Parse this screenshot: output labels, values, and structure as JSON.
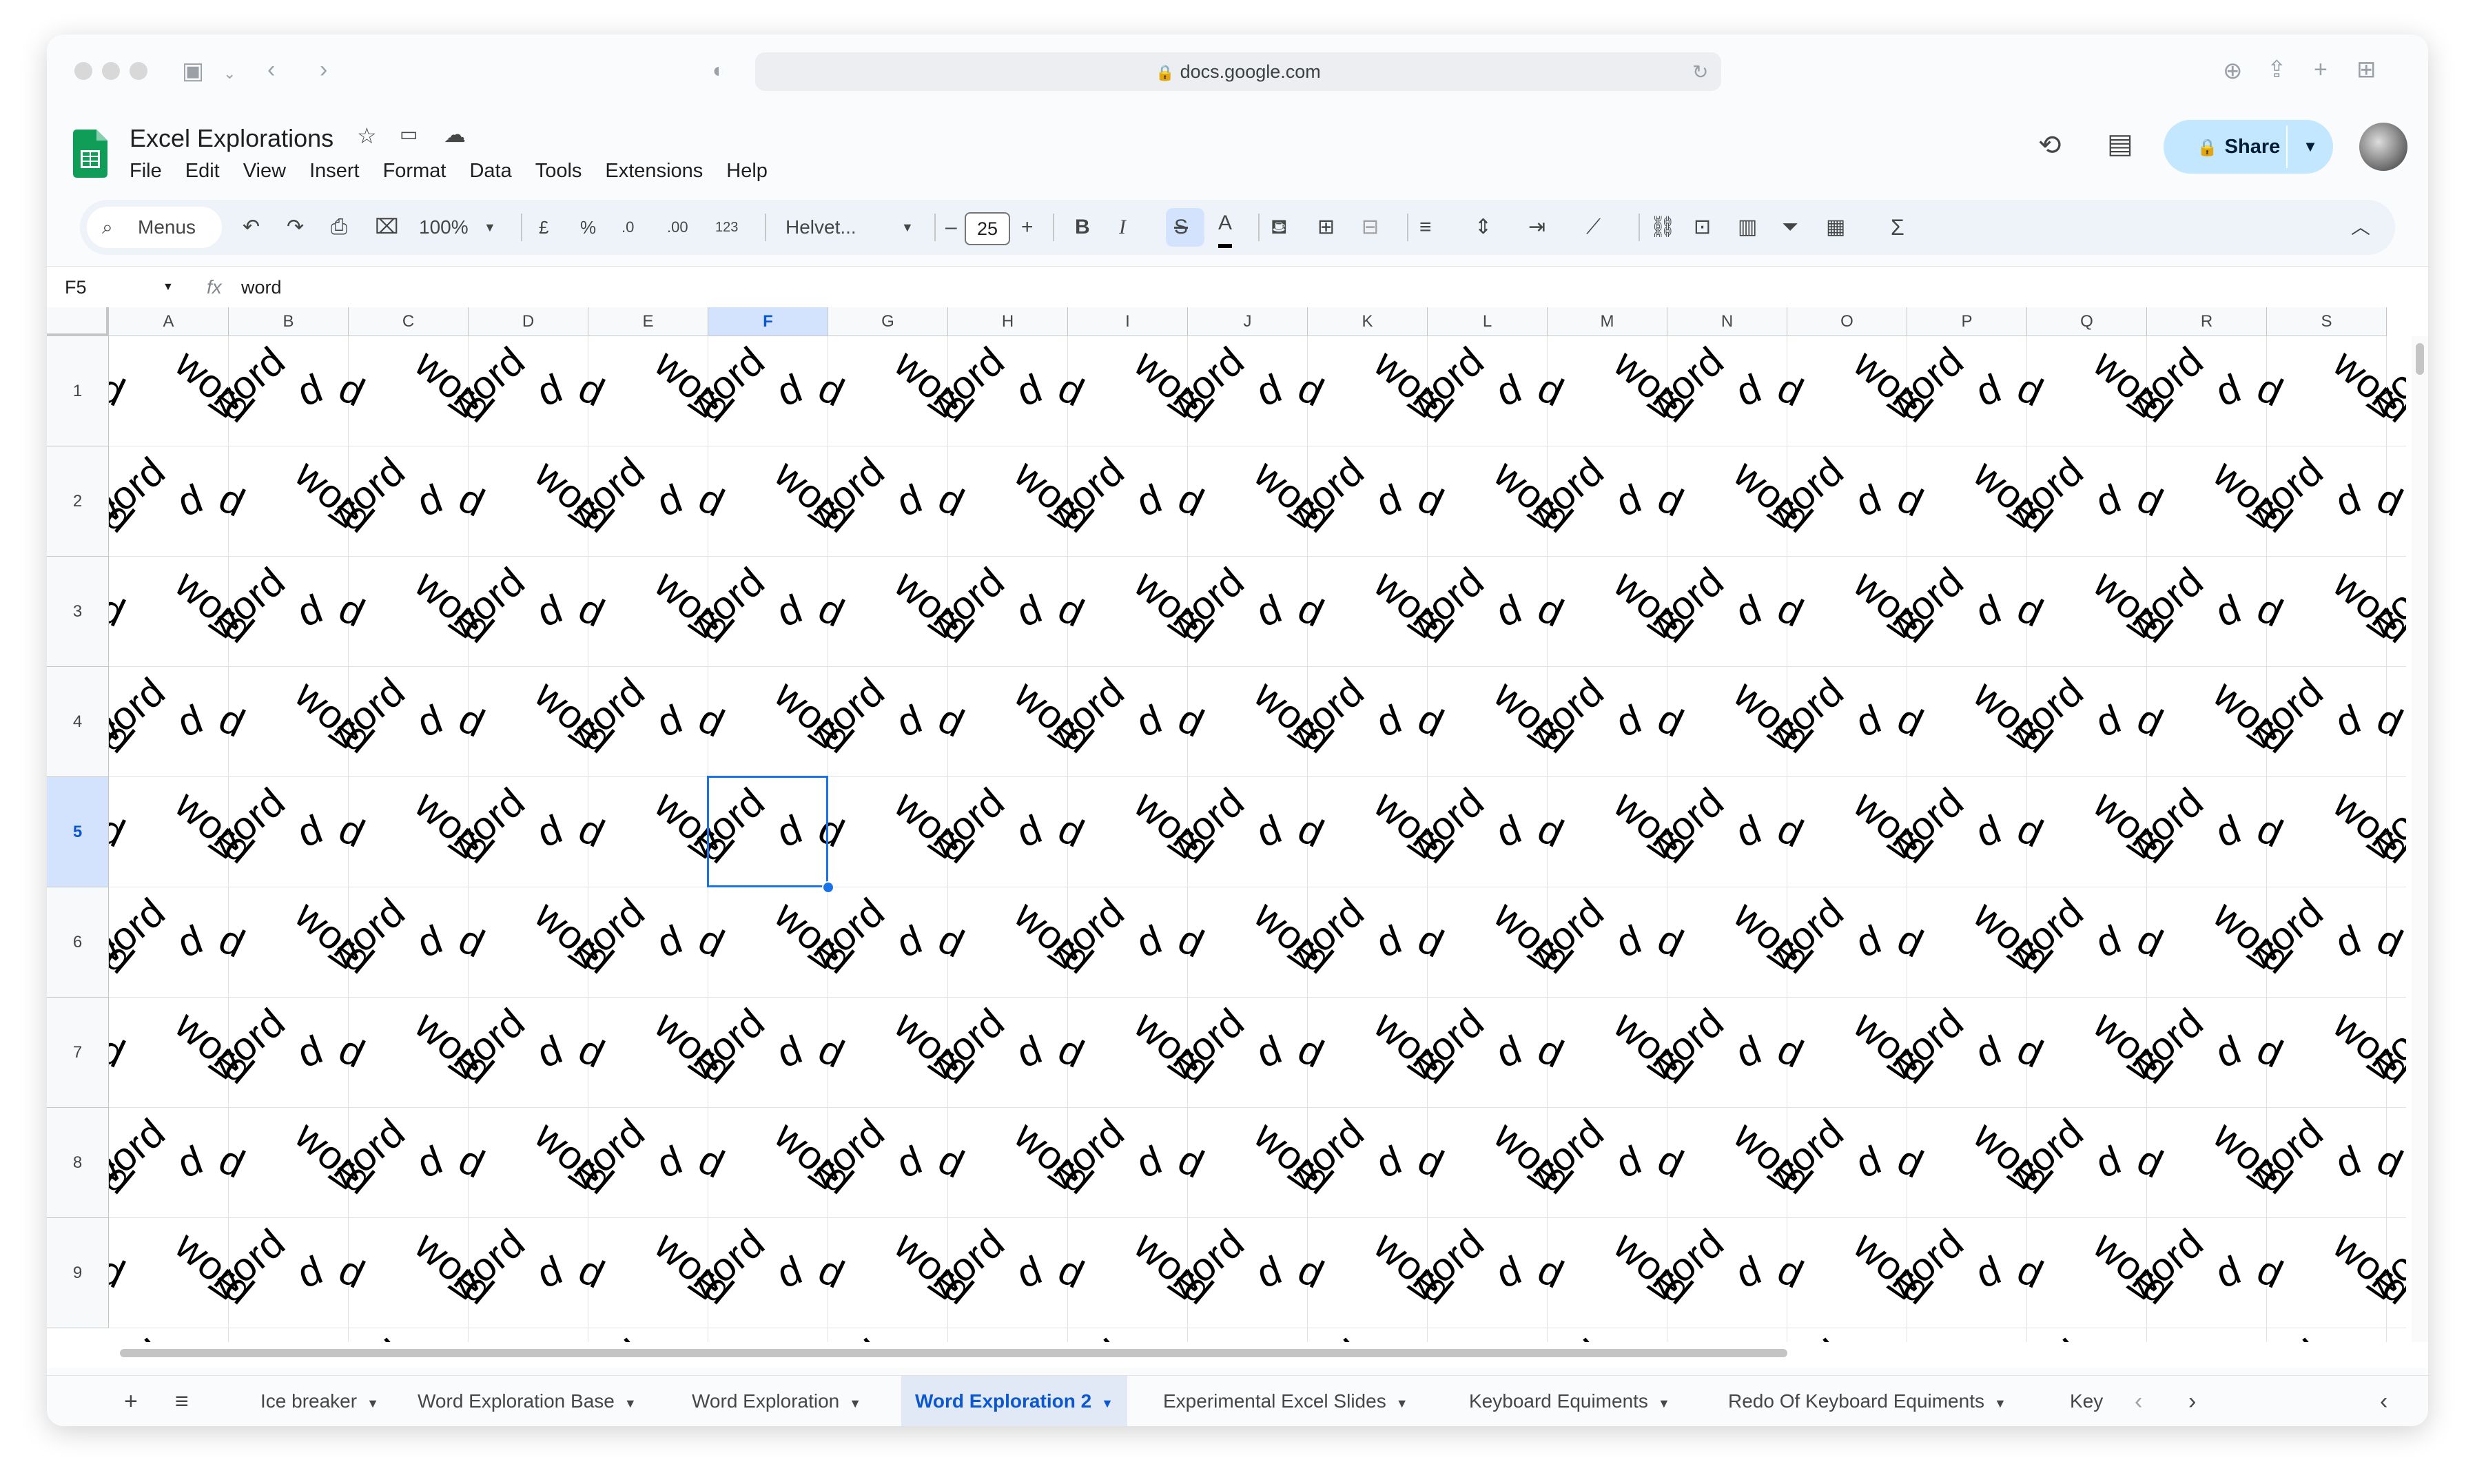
{
  "browser": {
    "url": "docs.google.com"
  },
  "document": {
    "title": "Excel Explorations"
  },
  "menu": [
    "File",
    "Edit",
    "View",
    "Insert",
    "Format",
    "Data",
    "Tools",
    "Extensions",
    "Help"
  ],
  "share": {
    "label": "Share"
  },
  "toolbar": {
    "search_label": "Menus",
    "zoom": "100%",
    "currency": "£",
    "percent": "%",
    "decrease_decimal": ".0",
    "increase_decimal": ".00",
    "number_format": "123",
    "font": "Helvet...",
    "font_size": "25",
    "bold": "B",
    "italic": "I",
    "text_color": "A",
    "sum": "Σ"
  },
  "formula_bar": {
    "cell_ref": "F5",
    "fx": "fx",
    "value": "word"
  },
  "sheet": {
    "columns": [
      "A",
      "B",
      "C",
      "D",
      "E",
      "F",
      "G",
      "H",
      "I",
      "J",
      "K",
      "L",
      "M",
      "N",
      "O",
      "P",
      "Q",
      "R",
      "S"
    ],
    "rows": [
      "1",
      "2",
      "3",
      "4",
      "5",
      "6",
      "7",
      "8",
      "9"
    ],
    "selected_cell": "F5",
    "cell_value": "word"
  },
  "tabs": [
    {
      "label": "Ice breaker",
      "active": false
    },
    {
      "label": "Word Exploration Base",
      "active": false
    },
    {
      "label": "Word Exploration",
      "active": false
    },
    {
      "label": "Word Exploration 2",
      "active": true
    },
    {
      "label": "Experimental Excel Slides",
      "active": false
    },
    {
      "label": "Keyboard Equiments",
      "active": false
    },
    {
      "label": "Redo Of Keyboard Equiments",
      "active": false
    },
    {
      "label": "Key",
      "active": false
    }
  ],
  "colors": {
    "accent": "#0b57d0",
    "share_bg": "#c2e7ff",
    "selection": "#1a73e8",
    "sheets_green": "#0f9d58"
  }
}
